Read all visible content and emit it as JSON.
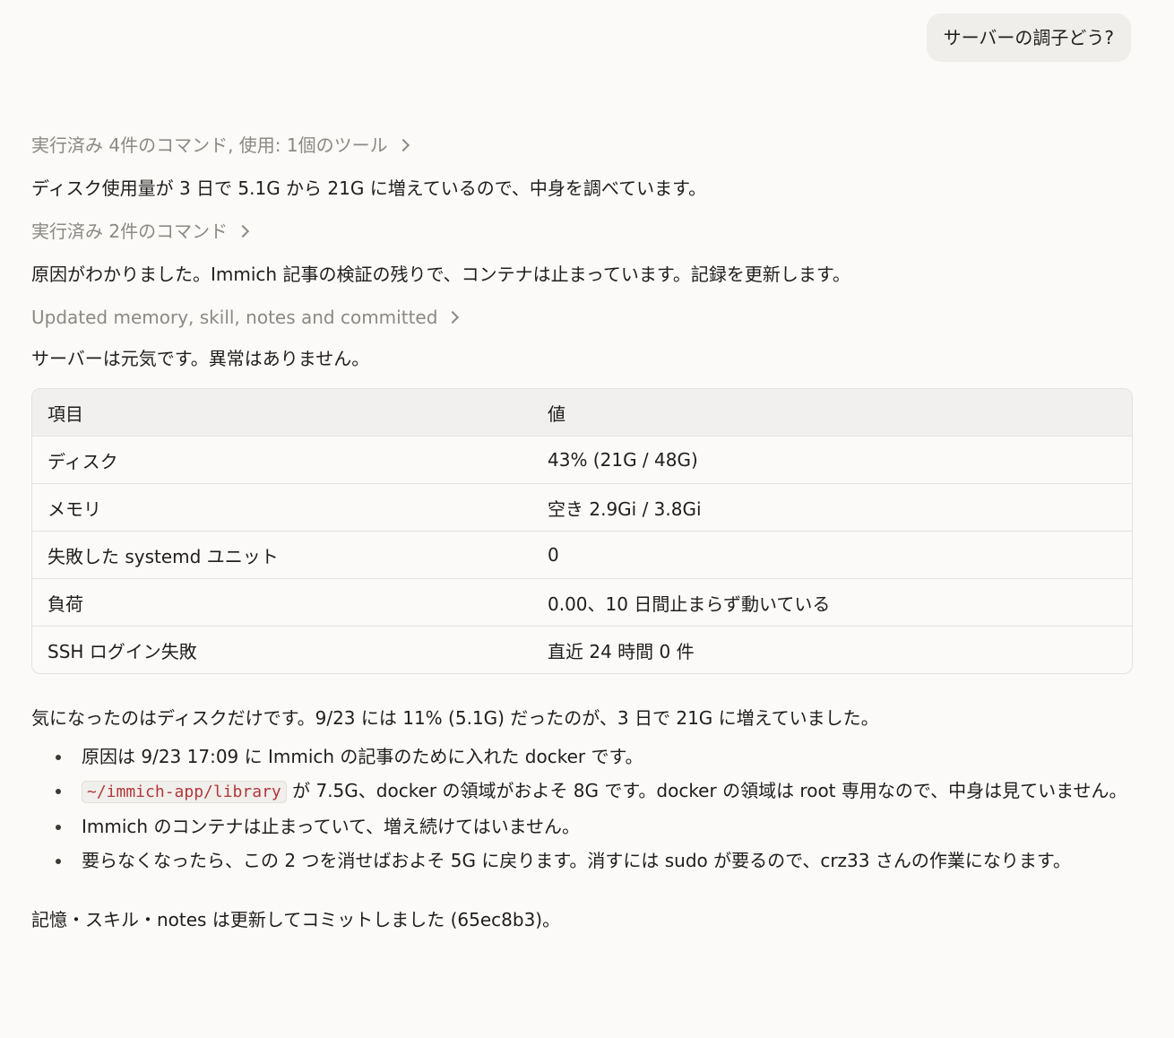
{
  "user_message": "サーバーの調子どう?",
  "steps": [
    {
      "summary": "実行済み 4件のコマンド, 使用: 1個のツール"
    },
    {
      "text": "ディスク使用量が 3 日で 5.1G から 21G に増えているので、中身を調べています。"
    },
    {
      "summary": "実行済み 2件のコマンド"
    },
    {
      "text": "原因がわかりました。Immich 記事の検証の残りで、コンテナは止まっています。記録を更新します。"
    },
    {
      "summary": "Updated memory, skill, notes and committed"
    },
    {
      "text": "サーバーは元気です。異常はありません。"
    }
  ],
  "table": {
    "headers": [
      "項目",
      "値"
    ],
    "rows": [
      [
        "ディスク",
        "43% (21G / 48G)"
      ],
      [
        "メモリ",
        "空き 2.9Gi / 3.8Gi"
      ],
      [
        "失敗した systemd ユニット",
        "0"
      ],
      [
        "負荷",
        "0.00、10 日間止まらず動いている"
      ],
      [
        "SSH ログイン失敗",
        "直近 24 時間 0 件"
      ]
    ]
  },
  "disk_note": "気になったのはディスクだけです。9/23 には 11% (5.1G) だったのが、3 日で 21G に増えていました。",
  "bullets": {
    "b1": "原因は 9/23 17:09 に Immich の記事のために入れた docker です。",
    "b2_code": "~/immich-app/library",
    "b2_text": " が 7.5G、docker の領域がおよそ 8G です。docker の領域は root 専用なので、中身は見ていません。",
    "b3": "Immich のコンテナは止まっていて、増え続けてはいません。",
    "b4": "要らなくなったら、この 2 つを消せばおよそ 5G に戻ります。消すには sudo が要るので、crz33 さんの作業になります。"
  },
  "final": "記憶・スキル・notes は更新してコミットしました (65ec8b3)。"
}
